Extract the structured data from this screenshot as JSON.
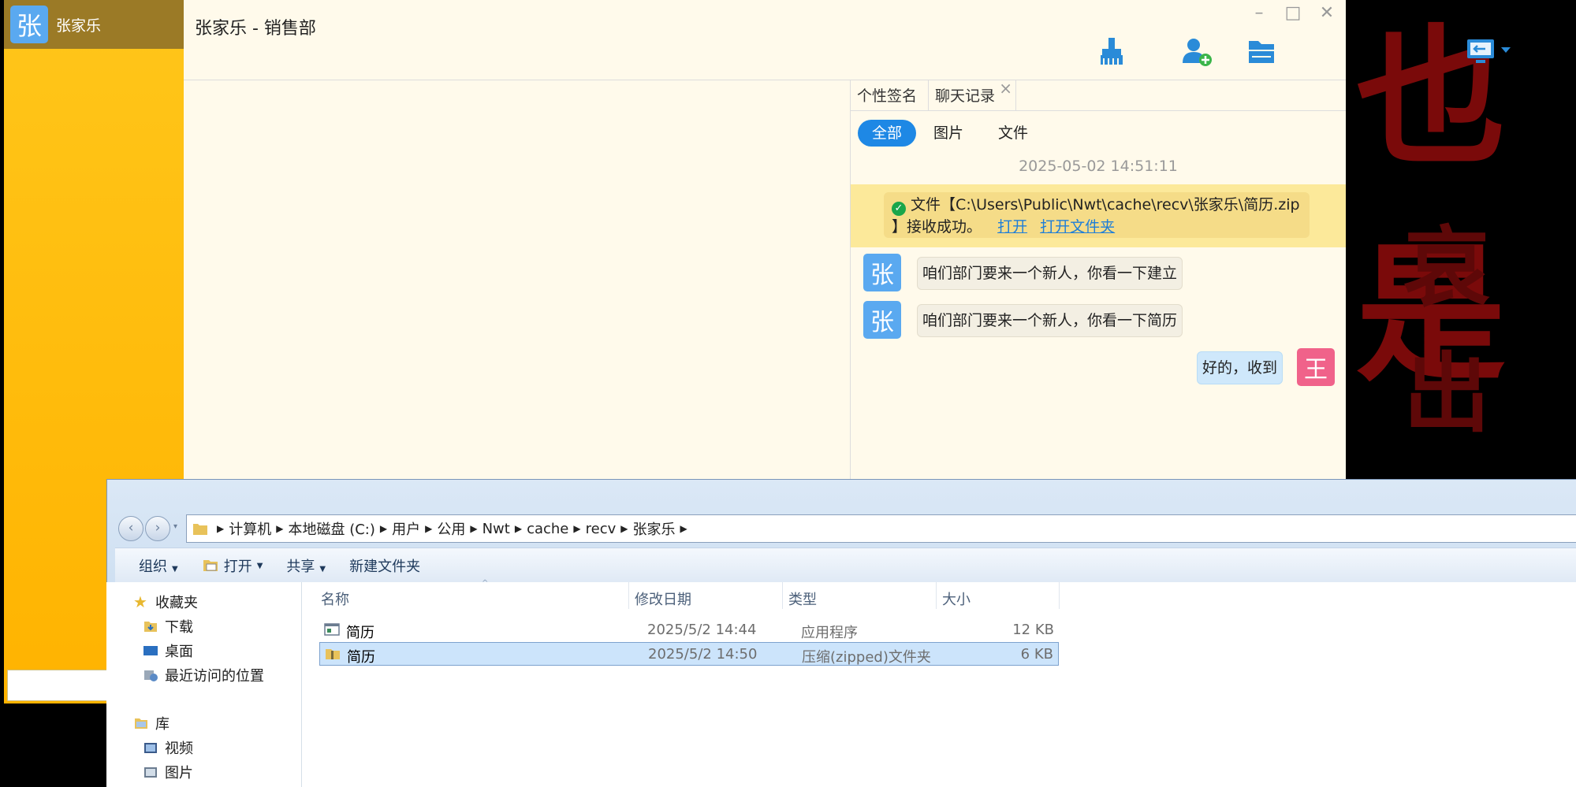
{
  "background_text": [
    "也是",
    "哀出"
  ],
  "left_window": {
    "avatar_char": "张",
    "user_name": "张家乐"
  },
  "chat_window": {
    "title": "张家乐 - 销售部",
    "window_controls": {
      "minimize": "–",
      "maximize": "□",
      "close": "✕"
    },
    "toolbar_icons": [
      "broom-icon",
      "add-contact-icon",
      "folder-share-icon",
      "remote-desktop-icon"
    ],
    "side_panel": {
      "tabs": [
        {
          "label": "个性签名"
        },
        {
          "label": "聊天记录",
          "close": "×"
        }
      ],
      "filters": [
        "全部",
        "图片",
        "文件"
      ],
      "timestamp": "2025-05-02 14:51:11",
      "notice": {
        "line1": "文件【C:\\Users\\Public\\Nwt\\cache\\recv\\张家乐\\简历.zip",
        "line2": "】接收成功。",
        "open_link": "打开",
        "open_folder_link": "打开文件夹"
      },
      "messages": [
        {
          "avatar": "张",
          "text": "咱们部门要来一个新人，你看一下建立",
          "mine": false
        },
        {
          "avatar": "张",
          "text": "咱们部门要来一个新人，你看一下简历",
          "mine": false
        },
        {
          "avatar": "王",
          "text": "好的，收到",
          "mine": true
        }
      ]
    }
  },
  "explorer": {
    "breadcrumb": [
      "计算机",
      "本地磁盘 (C:)",
      "用户",
      "公用",
      "Nwt",
      "cache",
      "recv",
      "张家乐"
    ],
    "toolbar": {
      "organize": "组织",
      "open": "打开",
      "share": "共享",
      "new_folder": "新建文件夹"
    },
    "nav": {
      "favorites": "收藏夹",
      "downloads": "下载",
      "desktop": "桌面",
      "recent": "最近访问的位置",
      "libraries": "库",
      "videos": "视频",
      "pictures": "图片"
    },
    "columns": {
      "name": "名称",
      "date": "修改日期",
      "type": "类型",
      "size": "大小"
    },
    "files": [
      {
        "name": "简历",
        "date": "2025/5/2 14:44",
        "type": "应用程序",
        "size": "12 KB"
      },
      {
        "name": "简历",
        "date": "2025/5/2 14:50",
        "type": "压缩(zipped)文件夹",
        "size": "6 KB"
      }
    ]
  }
}
